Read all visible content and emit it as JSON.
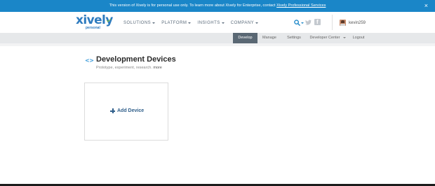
{
  "colors": {
    "banner": "#1a86c8",
    "brand": "#2e7bbf",
    "subnav_bg": "#e6e8ea",
    "subnav_active": "#5a6874",
    "add_device": "#2e5e8a"
  },
  "banner": {
    "text": "This version of Xively is for personal use only. To learn more about Xively for Enterprise, contact",
    "link": "Xively Professional Services",
    "close": "×"
  },
  "logo": {
    "word": "xively",
    "sub": "personal"
  },
  "nav": {
    "items": [
      {
        "label": "SOLUTIONS"
      },
      {
        "label": "PLATFORM"
      },
      {
        "label": "INSIGHTS"
      },
      {
        "label": "COMPANY"
      }
    ]
  },
  "header": {
    "icons": [
      "search-icon",
      "twitter-icon",
      "facebook-icon"
    ],
    "facebook_glyph": "f",
    "username": "kevin259"
  },
  "subnav": {
    "develop": "Develop",
    "manage": "Manage",
    "settings": "Settings",
    "developer_center": "Developer Center",
    "logout": "Logout",
    "active": "Develop"
  },
  "page": {
    "code_icon": "<>",
    "title": "Development Devices",
    "subtitle": "Prototype, experiment, research.",
    "more": "more"
  },
  "card": {
    "add_label": "Add Device"
  }
}
